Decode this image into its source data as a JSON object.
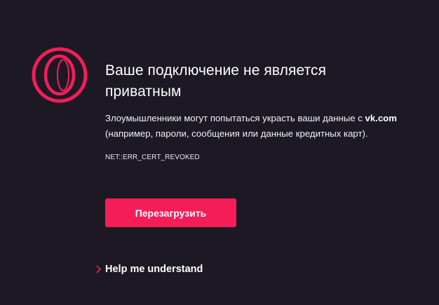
{
  "colors": {
    "background": "#1c1924",
    "accent": "#f51d58",
    "text": "#ffffff"
  },
  "logo": {
    "icon": "opera-gx-logo-icon"
  },
  "error": {
    "title": "Ваше подключение не является приватным",
    "description_before": "Злоумышленники могут попытаться украсть ваши данные с ",
    "domain": "vk.com",
    "description_after": " (например, пароли, сообщения или данные кредитных карт).",
    "code": "NET::ERR_CERT_REVOKED"
  },
  "actions": {
    "reload_label": "Перезагрузить",
    "help_label": "Help me understand",
    "help_icon": "chevron-right-icon"
  }
}
